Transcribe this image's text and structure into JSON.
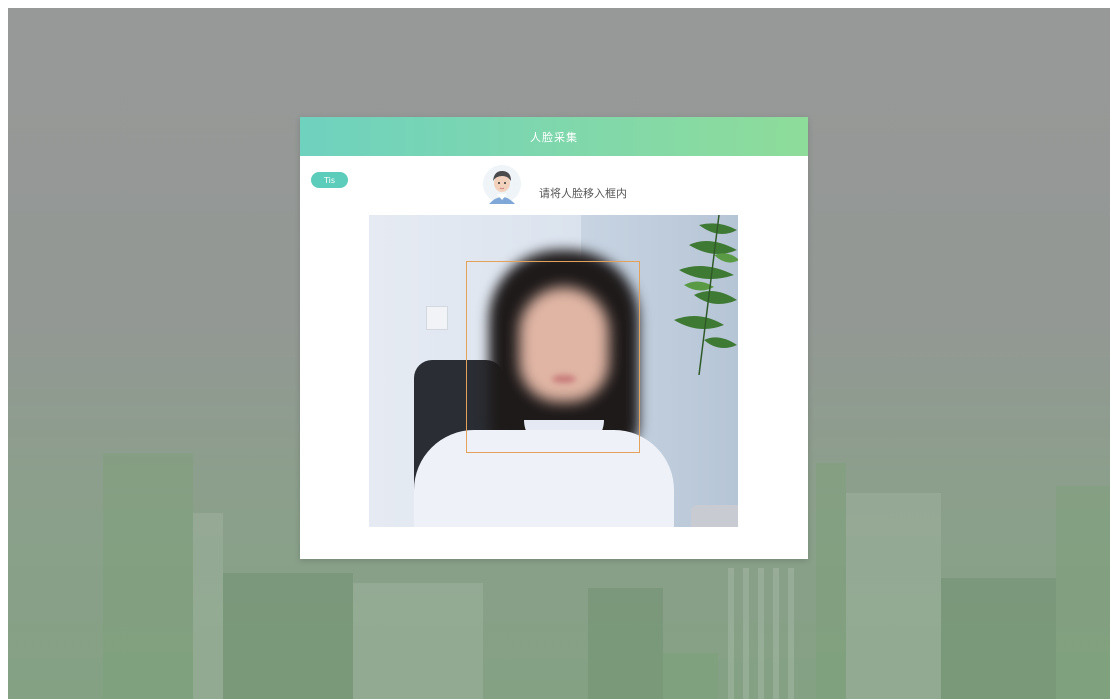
{
  "dialog": {
    "title": "人脸采集",
    "badge_label": "Tis",
    "prompt": "请将人脸移入框内"
  },
  "icons": {
    "avatar": "user-avatar-icon"
  },
  "colors": {
    "header_gradient_start": "#6fd2bf",
    "header_gradient_end": "#8edc9a",
    "badge": "#5ccdbb",
    "face_frame": "#e3a15a"
  }
}
